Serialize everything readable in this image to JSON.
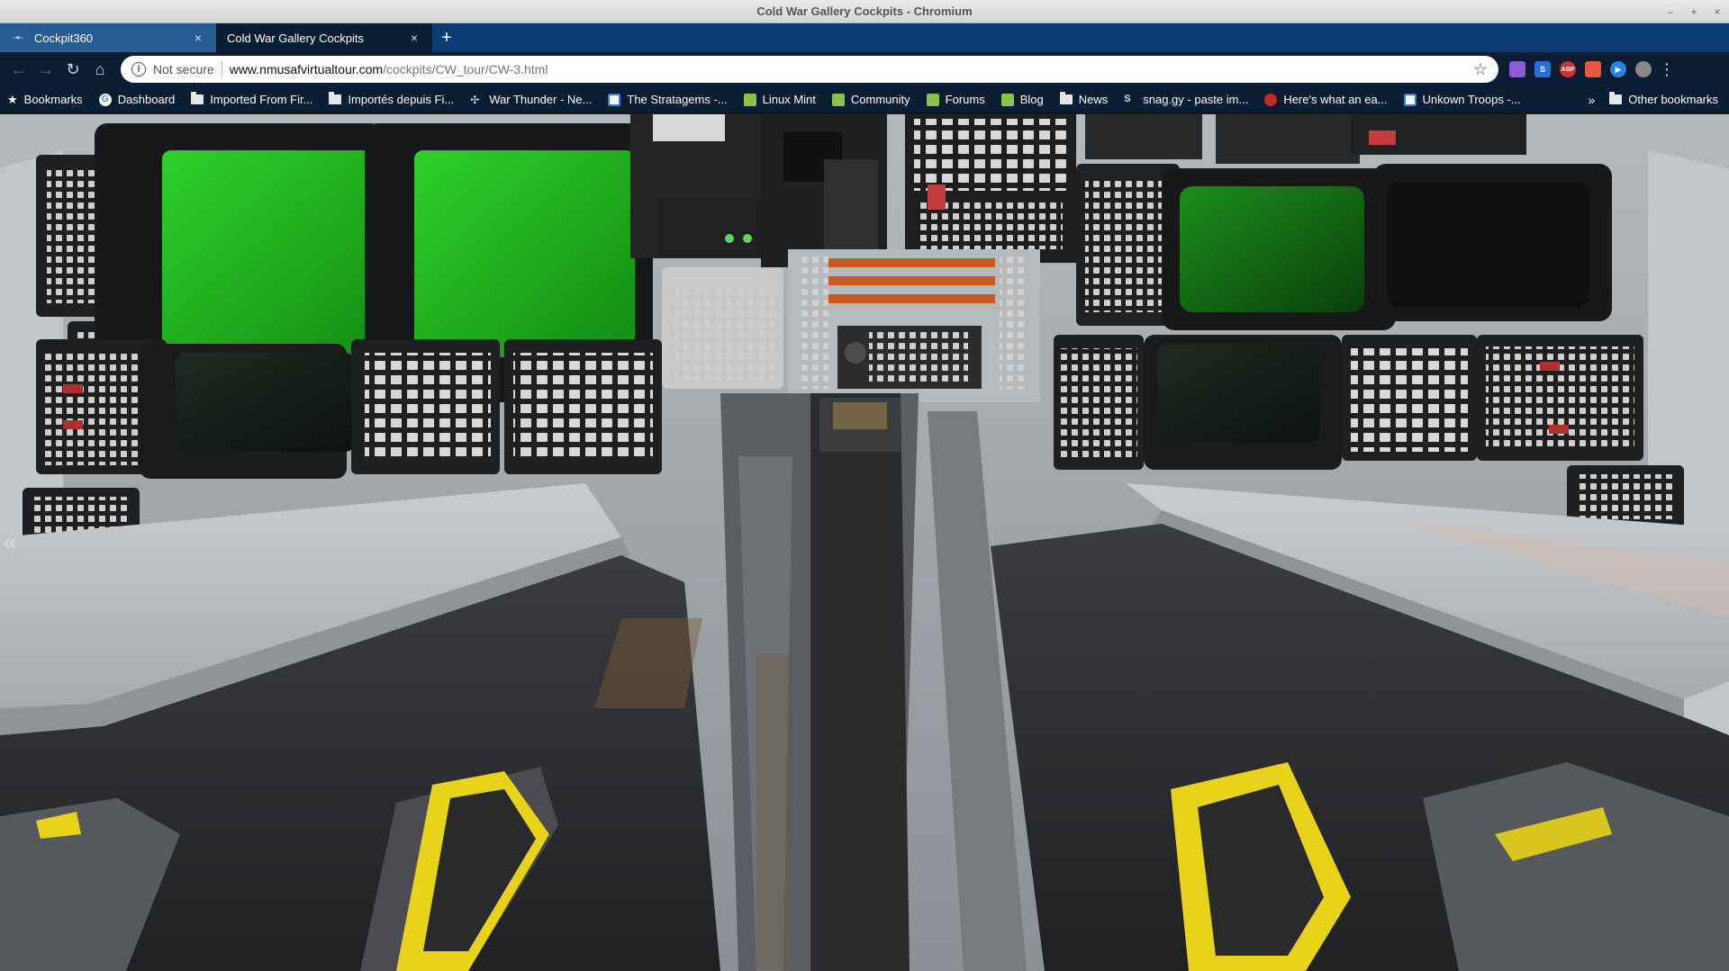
{
  "window": {
    "title": "Cold War Gallery Cockpits - Chromium",
    "controls": {
      "minimize": "–",
      "maximize": "+",
      "close": "×"
    }
  },
  "tabs": [
    {
      "label": "Cockpit360",
      "active": false,
      "close": "×"
    },
    {
      "label": "Cold War Gallery Cockpits",
      "active": true,
      "close": "×"
    }
  ],
  "new_tab_symbol": "+",
  "toolbar": {
    "back": "←",
    "forward": "→",
    "reload": "↻",
    "home": "⌂",
    "security_label": "Not secure",
    "url_host": "www.nmusafvirtualtour.com",
    "url_path": "/cockpits/CW_tour/CW-3.html",
    "star": "☆",
    "menu": "⋮"
  },
  "extensions": [
    {
      "name": "feather-extension-icon",
      "text": "",
      "color": "#8e5bd6"
    },
    {
      "name": "s-extension-icon",
      "text": "S",
      "color": "#2a6fd6"
    },
    {
      "name": "adblock-plus-icon",
      "text": "ABP",
      "color": "#d32f2f"
    },
    {
      "name": "megaphone-extension-icon",
      "text": "",
      "color": "#e55b3c"
    },
    {
      "name": "play-extension-icon",
      "text": "▶",
      "color": "#2b83e0"
    },
    {
      "name": "profile-avatar-icon",
      "text": "",
      "color": "#888888"
    }
  ],
  "bookmarks": {
    "items": [
      {
        "label": "Bookmarks",
        "icon": "star-icon"
      },
      {
        "label": "Dashboard",
        "icon": "google-icon"
      },
      {
        "label": "Imported From Fir...",
        "icon": "folder-icon"
      },
      {
        "label": "Importés depuis Fi...",
        "icon": "folder-icon"
      },
      {
        "label": "War Thunder - Ne...",
        "icon": "war-thunder-icon"
      },
      {
        "label": "The Stratagems -...",
        "icon": "page-icon"
      },
      {
        "label": "Linux Mint",
        "icon": "linux-mint-icon"
      },
      {
        "label": "Community",
        "icon": "linux-mint-icon"
      },
      {
        "label": "Forums",
        "icon": "linux-mint-icon"
      },
      {
        "label": "Blog",
        "icon": "linux-mint-icon"
      },
      {
        "label": "News",
        "icon": "folder-icon"
      },
      {
        "label": "snag.gy - paste im...",
        "icon": "snaggy-icon"
      },
      {
        "label": "Here's what an ea...",
        "icon": "power-icon"
      },
      {
        "label": "Unkown Troops -...",
        "icon": "page-icon"
      }
    ],
    "overflow": "»",
    "other": "Other bookmarks"
  },
  "panorama": {
    "description_visible": false,
    "left_nav_arrow": "«"
  }
}
